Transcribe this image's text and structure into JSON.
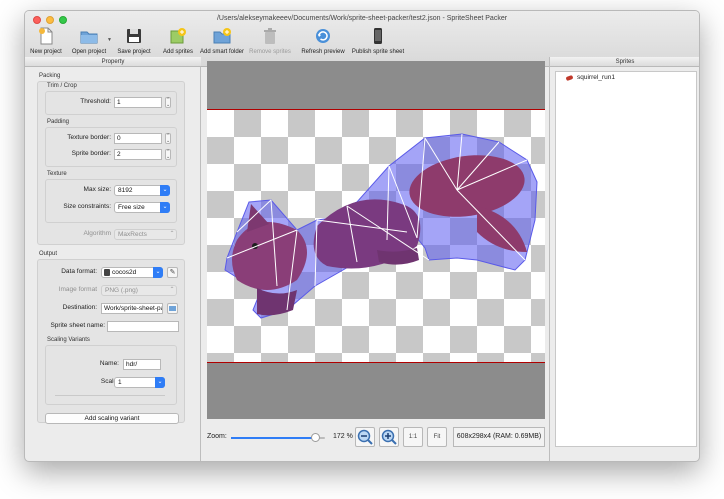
{
  "window": {
    "title": "/Users/alekseymakeeev/Documents/Work/sprite-sheet-packer/test2.json - SpriteSheet Packer",
    "traffic_light_colors": [
      "#fc605c",
      "#fdbc40",
      "#34c84a"
    ]
  },
  "toolbar": {
    "new_project": "New project",
    "open_project": "Open project",
    "save_project": "Save project",
    "add_sprites": "Add sprites",
    "add_smart_folder": "Add smart folder",
    "remove_sprites": "Remove sprites",
    "refresh_preview": "Refresh preview",
    "publish_sprite_sheet": "Publish sprite sheet",
    "icons": [
      "new-document-icon",
      "open-folder-icon",
      "save-disk-icon",
      "add-sprites-icon",
      "add-folder-icon",
      "trash-icon",
      "refresh-icon",
      "phone-icon"
    ]
  },
  "property_panel": {
    "header": "Property",
    "packing": {
      "title": "Packing",
      "trim_crop": {
        "title": "Trim / Crop",
        "threshold_label": "Threshold:",
        "threshold_value": "1"
      },
      "padding": {
        "title": "Padding",
        "texture_border_label": "Texture border:",
        "texture_border_value": "0",
        "sprite_border_label": "Sprite border:",
        "sprite_border_value": "2"
      },
      "texture": {
        "title": "Texture",
        "max_size_label": "Max size:",
        "max_size_value": "8192",
        "size_constraints_label": "Size constraints:",
        "size_constraints_value": "Free size"
      },
      "algorithm_label": "Algorithm",
      "algorithm_value": "MaxRects"
    },
    "output": {
      "title": "Output",
      "data_format_label": "Data format:",
      "data_format_value": "cocos2d",
      "image_format_label": "Image format",
      "image_format_value": "PNG (.png)",
      "destination_label": "Destination:",
      "destination_value": "Work/sprite-sheet-packer",
      "sprite_sheet_name_label": "Sprite sheet name:",
      "sprite_sheet_name_value": "",
      "scaling_variants": {
        "title": "Scaling Variants",
        "name_label": "Name:",
        "name_value": "hdr/",
        "scale_label": "Scale:",
        "scale_value": "1"
      },
      "add_scaling_variant": "Add scaling variant"
    }
  },
  "preview": {
    "zoom_label": "Zoom:",
    "zoom_percent": "172 %",
    "zoom_level_fraction": 0.9,
    "one_to_one": "1:1",
    "fit": "Fit",
    "info": "608x298x4 (RAM: 0.69MB)"
  },
  "sprites_panel": {
    "header": "Sprites",
    "items": [
      {
        "label": "squirrel_run1"
      }
    ]
  }
}
